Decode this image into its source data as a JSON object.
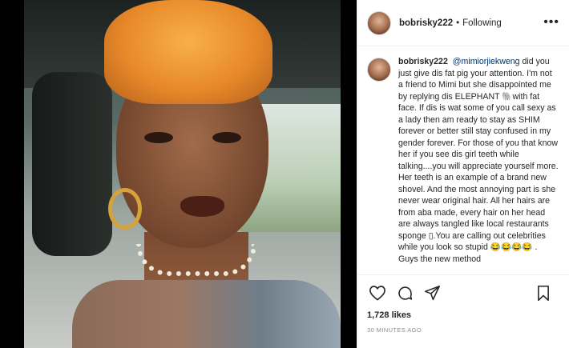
{
  "post": {
    "username": "bobrisky222",
    "separator": "•",
    "follow_status": "Following",
    "more_icon": "more-horizontal-icon"
  },
  "caption": {
    "username": "bobrisky222",
    "mention": "@mimiorjiekweng",
    "text": " did you just give dis fat pig your attention. I'm not a friend to Mimi but she disappointed me by replying dis ELEPHANT 🐘with fat face. If dis is wat some of you call sexy as a lady then am ready to stay as SHIM forever or better still stay confused in my gender forever. For those of you that know her if you see dis girl teeth while talking....you will appreciate yourself more. Her teeth is an example of a brand new shovel. And the most annoying part is she never wear original hair. All her hairs are from aba made, every hair on her head are always tangled like local restaurants sponge ▯.You are calling out celebrities while you look so stupid 😂😂😂😂 . Guys the new method"
  },
  "actions": {
    "icons": [
      "heart-icon",
      "comment-icon",
      "share-icon",
      "bookmark-icon"
    ],
    "likes": "1,728 likes",
    "time": "30 MINUTES AGO"
  },
  "colors": {
    "text": "#262626",
    "muted": "#8e8e8e",
    "link": "#003569",
    "border": "#efefef",
    "media_bg": "#000000"
  }
}
